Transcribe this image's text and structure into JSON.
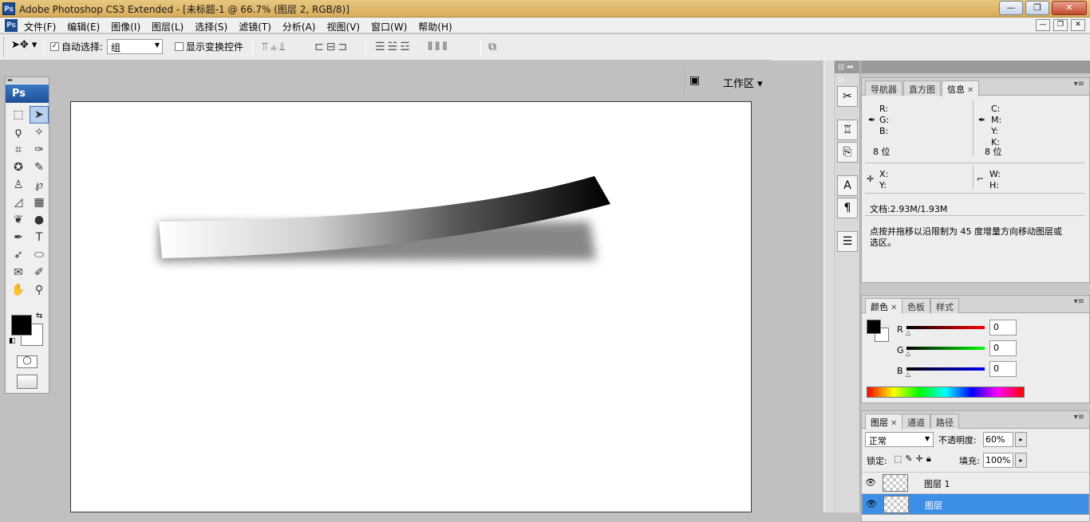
{
  "title_bar": {
    "app_icon": "Ps",
    "title": "Adobe Photoshop CS3 Extended - [未标题-1 @ 66.7% (图层 2, RGB/8)]",
    "btn_min": "—",
    "btn_max": "❐",
    "btn_close": "✕"
  },
  "menu_bar": {
    "app_icon": "Ps",
    "items": [
      "文件(F)",
      "编辑(E)",
      "图像(I)",
      "图层(L)",
      "选择(S)",
      "滤镜(T)",
      "分析(A)",
      "视图(V)",
      "窗口(W)",
      "帮助(H)"
    ],
    "mdi_min": "—",
    "mdi_restore": "❐",
    "mdi_close": "✕"
  },
  "options_bar": {
    "tool_icon": "move-tool-icon",
    "auto_select_checked": true,
    "auto_select_label": "自动选择:",
    "auto_select_value": "组",
    "show_transform_checked": false,
    "show_transform_label": "显示变换控件",
    "workspace_label": "工作区"
  },
  "canvas": {
    "document": "未标题-1",
    "zoom": "66.7%",
    "active_layer": "图层 2",
    "mode": "RGB/8"
  },
  "info_panel": {
    "tabs": [
      "导航器",
      "直方图",
      "信息"
    ],
    "active_tab": "信息",
    "r": "R:",
    "g": "G:",
    "b": "B:",
    "c": "C:",
    "m": "M:",
    "y": "Y:",
    "k": "K:",
    "bits_left": "8 位",
    "bits_right": "8 位",
    "x": "X:",
    "y2": "Y:",
    "w": "W:",
    "h": "H:",
    "doc_size": "文档:2.93M/1.93M",
    "hint_line1": "点按并拖移以沿限制为 45 度增量方向移动图层或",
    "hint_line2": "选区。"
  },
  "color_panel": {
    "tabs": [
      "颜色",
      "色板",
      "样式"
    ],
    "active_tab": "颜色",
    "r_label": "R",
    "g_label": "G",
    "b_label": "B",
    "r_value": "0",
    "g_value": "0",
    "b_value": "0",
    "foreground": "#000000",
    "background": "#ffffff"
  },
  "layers_panel": {
    "tabs": [
      "图层",
      "通道",
      "路径"
    ],
    "active_tab": "图层",
    "blend_mode": "正常",
    "opacity_label": "不透明度:",
    "opacity_value": "60%",
    "lock_label": "锁定:",
    "fill_label": "填充:",
    "fill_value": "100%",
    "layers": [
      {
        "name": "图层 1",
        "selected": false
      },
      {
        "name": "图层",
        "selected": true
      }
    ]
  }
}
